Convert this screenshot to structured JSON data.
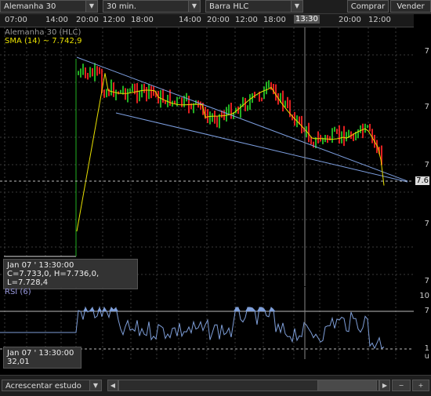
{
  "toolbar": {
    "instrument": "Alemanha 30",
    "interval": "30 min.",
    "chart_type": "Barra HLC",
    "buy": "Comprar",
    "sell": "Vender",
    "dropdown_icon": "chevron-down-icon"
  },
  "time_axis": {
    "labels": [
      "07:00",
      "14:00",
      "20:00",
      "12:00",
      "18:00",
      "14:00",
      "20:00",
      "12:00",
      "18:00",
      "13:30",
      "20:00",
      "12:00"
    ],
    "highlight": "13:30"
  },
  "price_panel": {
    "title": "Alemanha 30 (HLC)",
    "sma_label": "SMA (14) ~ 7.742,9",
    "current_price_label": "7.6",
    "right_labels": [
      "7",
      "7",
      "7",
      "7",
      "7",
      "7",
      "7"
    ],
    "tooltip_date": "Jan 07 ' 13:30:00",
    "tooltip_ohlc": "C=7.733,0, H=7.736,0, L=7.728,4"
  },
  "rsi_panel": {
    "title": "RSI (6)",
    "tooltip_date": "Jan 07 ' 13:30:00",
    "tooltip_value": "32,01",
    "right_labels": [
      "10",
      "7",
      "1",
      "u"
    ]
  },
  "bottom": {
    "add_study": "Acrescentar estudo",
    "scroll_left_icon": "chevron-left-icon",
    "scroll_right_icon": "chevron-right-icon"
  },
  "colors": {
    "up_bar": "#22b022",
    "down_bar": "#e02020",
    "sma": "#e8e000",
    "channel": "#7d9fe0",
    "rsi_fill": "#7e9ed8",
    "grid": "#3a3a3a"
  }
}
